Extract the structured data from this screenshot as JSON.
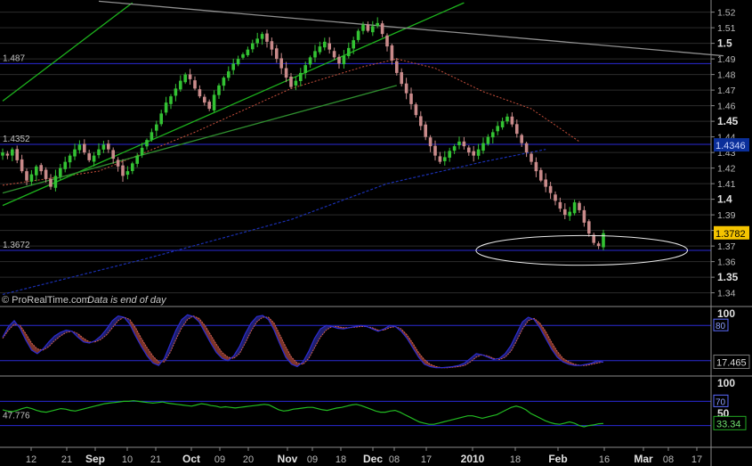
{
  "source_text": "© ProRealTime.com",
  "note_text": "Data is end of day",
  "chart_data": [
    {
      "type": "candlestick",
      "price_axis": {
        "ticks": [
          1.52,
          1.51,
          1.5,
          1.49,
          1.48,
          1.47,
          1.46,
          1.45,
          1.44,
          1.43,
          1.42,
          1.41,
          1.4,
          1.39,
          1.38,
          1.37,
          1.36,
          1.35,
          1.34
        ],
        "tick_labels": [
          "1.52",
          "1.51",
          "1.5",
          "1.49",
          "1.48",
          "1.47",
          "1.46",
          "1.45",
          "1.44",
          "1.43",
          "1.42",
          "1.41",
          "1.4",
          "1.39",
          "1.38",
          "1.37",
          "1.36",
          "1.35",
          "1.34"
        ],
        "bold_ticks": [
          "1.5",
          "1.45",
          "1.4",
          "1.35"
        ],
        "ylim": [
          1.3335,
          1.5255
        ]
      },
      "levels": [
        {
          "value": 1.487,
          "label": "1.487"
        },
        {
          "value": 1.4352,
          "label": "1.4352"
        },
        {
          "value": 1.3672,
          "label": "1.3672"
        }
      ],
      "last_price": {
        "value": 1.3782,
        "label": "1.3782"
      },
      "highlight_badge": {
        "value": 1.4346,
        "label": "1.4346"
      },
      "close_path": [
        1.43,
        1.428,
        1.432,
        1.425,
        1.418,
        1.412,
        1.416,
        1.421,
        1.418,
        1.413,
        1.408,
        1.415,
        1.42,
        1.424,
        1.428,
        1.432,
        1.435,
        1.43,
        1.425,
        1.428,
        1.432,
        1.435,
        1.432,
        1.426,
        1.421,
        1.415,
        1.418,
        1.423,
        1.428,
        1.433,
        1.438,
        1.443,
        1.448,
        1.455,
        1.462,
        1.466,
        1.471,
        1.476,
        1.48,
        1.477,
        1.471,
        1.466,
        1.462,
        1.458,
        1.467,
        1.473,
        1.478,
        1.482,
        1.487,
        1.49,
        1.493,
        1.496,
        1.5,
        1.503,
        1.506,
        1.501,
        1.496,
        1.49,
        1.484,
        1.478,
        1.472,
        1.476,
        1.481,
        1.486,
        1.491,
        1.495,
        1.498,
        1.501,
        1.496,
        1.491,
        1.487,
        1.492,
        1.497,
        1.502,
        1.508,
        1.512,
        1.508,
        1.511,
        1.513,
        1.506,
        1.498,
        1.489,
        1.481,
        1.474,
        1.468,
        1.461,
        1.454,
        1.447,
        1.44,
        1.434,
        1.428,
        1.424,
        1.427,
        1.431,
        1.434,
        1.437,
        1.434,
        1.43,
        1.428,
        1.432,
        1.436,
        1.44,
        1.443,
        1.447,
        1.45,
        1.453,
        1.448,
        1.442,
        1.436,
        1.43,
        1.424,
        1.418,
        1.412,
        1.408,
        1.404,
        1.399,
        1.394,
        1.39,
        1.392,
        1.398,
        1.393,
        1.385,
        1.378,
        1.372,
        1.37,
        1.3782
      ],
      "ma_dashed_red": [
        {
          "i": 0,
          "v": 1.409
        },
        {
          "i": 20,
          "v": 1.418
        },
        {
          "i": 40,
          "v": 1.443
        },
        {
          "i": 60,
          "v": 1.471
        },
        {
          "i": 75,
          "v": 1.485
        },
        {
          "i": 82,
          "v": 1.49
        },
        {
          "i": 90,
          "v": 1.484
        },
        {
          "i": 100,
          "v": 1.469
        },
        {
          "i": 110,
          "v": 1.458
        },
        {
          "i": 120,
          "v": 1.437
        }
      ],
      "ma_dashed_blue": [
        {
          "i": 0,
          "v": 1.339
        },
        {
          "i": 30,
          "v": 1.362
        },
        {
          "i": 60,
          "v": 1.387
        },
        {
          "i": 80,
          "v": 1.41
        },
        {
          "i": 100,
          "v": 1.424
        },
        {
          "i": 113,
          "v": 1.432
        }
      ],
      "trendlines": [
        {
          "color": "#1db21d",
          "from": {
            "i": 0,
            "v": 1.463
          },
          "to": {
            "i": 27,
            "v": 1.526
          }
        },
        {
          "color": "#1db21d",
          "from": {
            "i": 0,
            "v": 1.396
          },
          "to": {
            "i": 96,
            "v": 1.526
          }
        },
        {
          "color": "#2f8f2f",
          "from": {
            "i": 0,
            "v": 1.404
          },
          "to": {
            "i": 82,
            "v": 1.473
          }
        },
        {
          "color": "#909090",
          "from": {
            "i": 20,
            "v": 1.527
          },
          "to": {
            "i": 150,
            "v": 1.492
          }
        }
      ],
      "highlight_ellipse": {
        "i": 120.5,
        "v": 1.3672,
        "rx_bars": 22,
        "ry_value": 0.0095
      }
    },
    {
      "type": "line",
      "name": "stochastic",
      "ylim": [
        0,
        100
      ],
      "tick_labels": [
        "100"
      ],
      "levels": [
        {
          "value": 80,
          "label": "80"
        },
        {
          "value": 20,
          "label": "20"
        }
      ],
      "last_value": {
        "value": 17.465,
        "label": "17.465"
      },
      "k": [
        60,
        78,
        88,
        75,
        55,
        38,
        32,
        40,
        52,
        62,
        68,
        72,
        70,
        60,
        52,
        50,
        54,
        62,
        74,
        88,
        96,
        94,
        82,
        62,
        44,
        28,
        16,
        12,
        24,
        48,
        72,
        90,
        98,
        95,
        86,
        68,
        50,
        34,
        24,
        20,
        28,
        44,
        66,
        84,
        95,
        97,
        90,
        72,
        48,
        26,
        14,
        10,
        18,
        36,
        58,
        74,
        80,
        78,
        75,
        74,
        76,
        78,
        80,
        78,
        74,
        70,
        74,
        80,
        78,
        70,
        58,
        42,
        26,
        14,
        10,
        8,
        8,
        9,
        10,
        12,
        16,
        24,
        32,
        30,
        26,
        22,
        24,
        32,
        46,
        66,
        86,
        94,
        90,
        76,
        58,
        40,
        26,
        18,
        14,
        12,
        12,
        14,
        16,
        20,
        17.465
      ],
      "d": [
        58,
        72,
        82,
        80,
        66,
        50,
        40,
        38,
        44,
        54,
        62,
        68,
        70,
        66,
        58,
        52,
        52,
        56,
        64,
        76,
        88,
        94,
        90,
        76,
        58,
        42,
        28,
        18,
        18,
        34,
        56,
        76,
        90,
        96,
        92,
        80,
        64,
        48,
        34,
        26,
        24,
        32,
        50,
        70,
        86,
        94,
        94,
        84,
        64,
        44,
        26,
        16,
        14,
        24,
        42,
        60,
        72,
        78,
        78,
        76,
        76,
        77,
        78,
        78,
        76,
        72,
        72,
        76,
        78,
        74,
        64,
        50,
        34,
        22,
        14,
        10,
        8,
        8,
        9,
        10,
        12,
        18,
        26,
        30,
        28,
        24,
        22,
        26,
        36,
        54,
        74,
        88,
        92,
        84,
        70,
        52,
        36,
        24,
        18,
        14,
        12,
        12,
        14,
        16,
        18
      ]
    },
    {
      "type": "line",
      "name": "rsi",
      "ylim": [
        0,
        100
      ],
      "tick_labels": [
        "100",
        "50"
      ],
      "levels": [
        {
          "value": 70,
          "label": "70"
        },
        {
          "value": 30,
          "label": "30"
        }
      ],
      "first_value": {
        "value": 47.776,
        "label": "47.776"
      },
      "last_value": {
        "value": 33.34,
        "label": "33.34"
      },
      "values": [
        56,
        54,
        53,
        55,
        58,
        60,
        58,
        55,
        53,
        52,
        54,
        56,
        58,
        57,
        55,
        54,
        56,
        58,
        60,
        62,
        64,
        66,
        67,
        68,
        69,
        70,
        70,
        71,
        70,
        69,
        68,
        67,
        68,
        69,
        67,
        66,
        65,
        64,
        63,
        62,
        64,
        66,
        65,
        63,
        62,
        60,
        61,
        60,
        59,
        60,
        61,
        62,
        63,
        64,
        65,
        64,
        60,
        56,
        54,
        55,
        57,
        58,
        59,
        60,
        60,
        58,
        56,
        55,
        57,
        59,
        60,
        62,
        64,
        65,
        63,
        60,
        57,
        54,
        52,
        52,
        54,
        55,
        52,
        48,
        44,
        40,
        36,
        34,
        32,
        32,
        34,
        36,
        38,
        40,
        42,
        44,
        46,
        46,
        44,
        42,
        44,
        46,
        48,
        52,
        56,
        60,
        62,
        60,
        56,
        50,
        46,
        42,
        38,
        35,
        33,
        32,
        34,
        36,
        34,
        30,
        28,
        30,
        31,
        33,
        33.34
      ]
    }
  ],
  "time_axis": {
    "labels": [
      {
        "i": 4,
        "text": "12",
        "bold": false
      },
      {
        "i": 9,
        "text": "21",
        "bold": false
      },
      {
        "i": 13,
        "text": "Sep",
        "bold": true
      },
      {
        "i": 17.5,
        "text": "10",
        "bold": false
      },
      {
        "i": 21.5,
        "text": "21",
        "bold": false
      },
      {
        "i": 26.5,
        "text": "Oct",
        "bold": true
      },
      {
        "i": 30.5,
        "text": "09",
        "bold": false
      },
      {
        "i": 34.5,
        "text": "20",
        "bold": false
      },
      {
        "i": 40,
        "text": "Nov",
        "bold": true
      },
      {
        "i": 43.5,
        "text": "09",
        "bold": false
      },
      {
        "i": 47.5,
        "text": "18",
        "bold": false
      },
      {
        "i": 52,
        "text": "Dec",
        "bold": true
      },
      {
        "i": 55,
        "text": "08",
        "bold": false
      },
      {
        "i": 59.5,
        "text": "17",
        "bold": false
      },
      {
        "i": 66,
        "text": "2010",
        "bold": true
      },
      {
        "i": 72,
        "text": "18",
        "bold": false
      },
      {
        "i": 78,
        "text": "Feb",
        "bold": true
      },
      {
        "i": 84.5,
        "text": "16",
        "bold": false
      },
      {
        "i": 90,
        "text": "Mar",
        "bold": true
      },
      {
        "i": 93.5,
        "text": "08",
        "bold": false
      },
      {
        "i": 97.5,
        "text": "17",
        "bold": false
      }
    ]
  },
  "colors": {
    "background": "#000000",
    "grid": "#2b2b2b",
    "level_line": "#2a2ad6",
    "up_candle": "#33c233",
    "down_candle": "#c98a8a",
    "ma_red": "#c8503c",
    "ma_blue": "#1a2fb0",
    "stoch_k": "#2b2bd0",
    "stoch_fill": "#8a3a2e",
    "rsi_line": "#22bb22",
    "text": "#c8c8c8",
    "price_badge": "#f5c400",
    "highlight_badge": "#0b2f9a"
  }
}
